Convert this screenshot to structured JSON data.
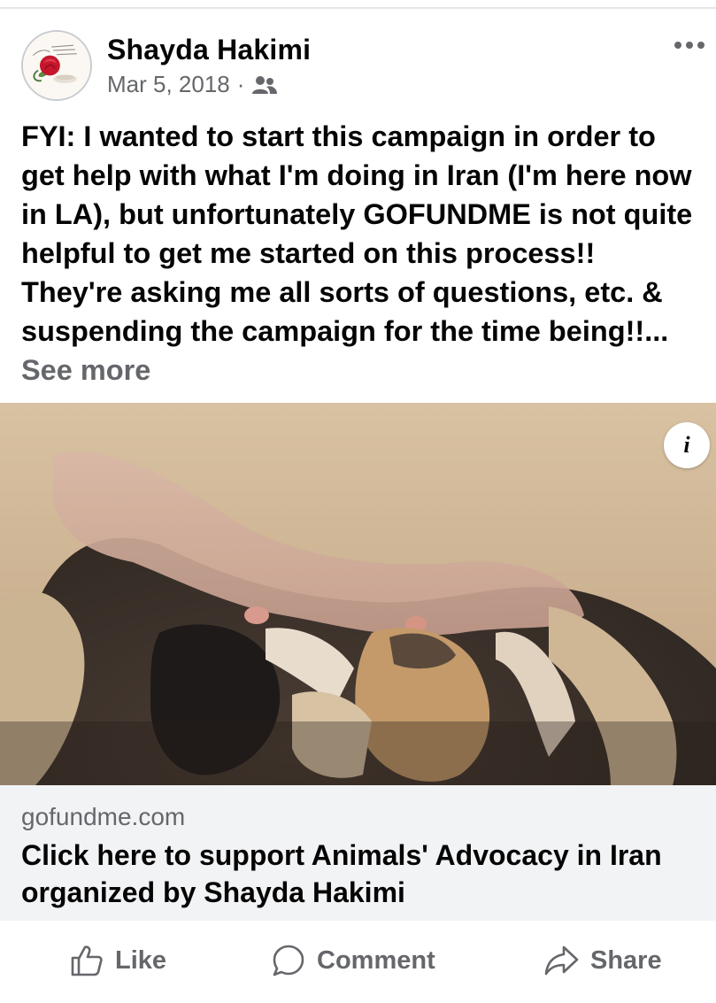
{
  "post": {
    "author": "Shayda Hakimi",
    "date": "Mar 5, 2018",
    "separator": "·",
    "audience_icon": "friends-icon",
    "more_icon": "more-horizontal-icon",
    "text": "FYI: I wanted to start this campaign in order to get help with what I'm doing in Iran (I'm here now in LA), but unfortunately GOFUNDME is not quite helpful to get me started on this process!! They're asking me all sorts of questions, etc. & suspending the campaign for the time being!!...",
    "see_more": "See more"
  },
  "image": {
    "info_label": "i"
  },
  "link_preview": {
    "domain": "gofundme.com",
    "title": "Click here to support Animals' Advocacy in Iran organized by Shayda Hakimi"
  },
  "actions": {
    "like": "Like",
    "comment": "Comment",
    "share": "Share"
  },
  "colors": {
    "text_primary": "#050505",
    "text_secondary": "#65676b",
    "preview_background": "#f2f3f5",
    "divider": "#e4e6eb"
  }
}
